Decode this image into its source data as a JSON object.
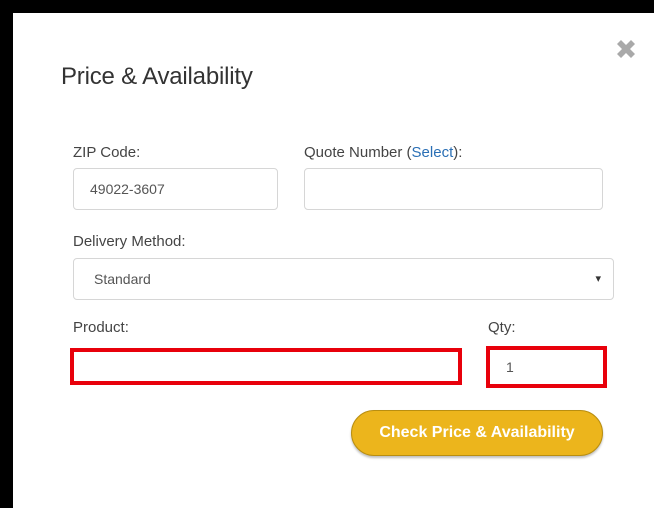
{
  "modal": {
    "title": "Price & Availability",
    "close_icon": "close-x-icon"
  },
  "zip": {
    "label": "ZIP Code:",
    "value": "49022-3607"
  },
  "quote": {
    "label_prefix": "Quote Number (",
    "link_text": "Select",
    "label_suffix": "):",
    "value": ""
  },
  "delivery": {
    "label": "Delivery Method:",
    "selected": "Standard",
    "caret": "▾"
  },
  "product": {
    "label": "Product:",
    "value": ""
  },
  "qty": {
    "label": "Qty:",
    "value": "1"
  },
  "actions": {
    "submit_label": "Check Price & Availability"
  },
  "colors": {
    "accent_button": "#ecb51c",
    "link": "#2a6fb5",
    "highlight_border": "#e8000b"
  }
}
